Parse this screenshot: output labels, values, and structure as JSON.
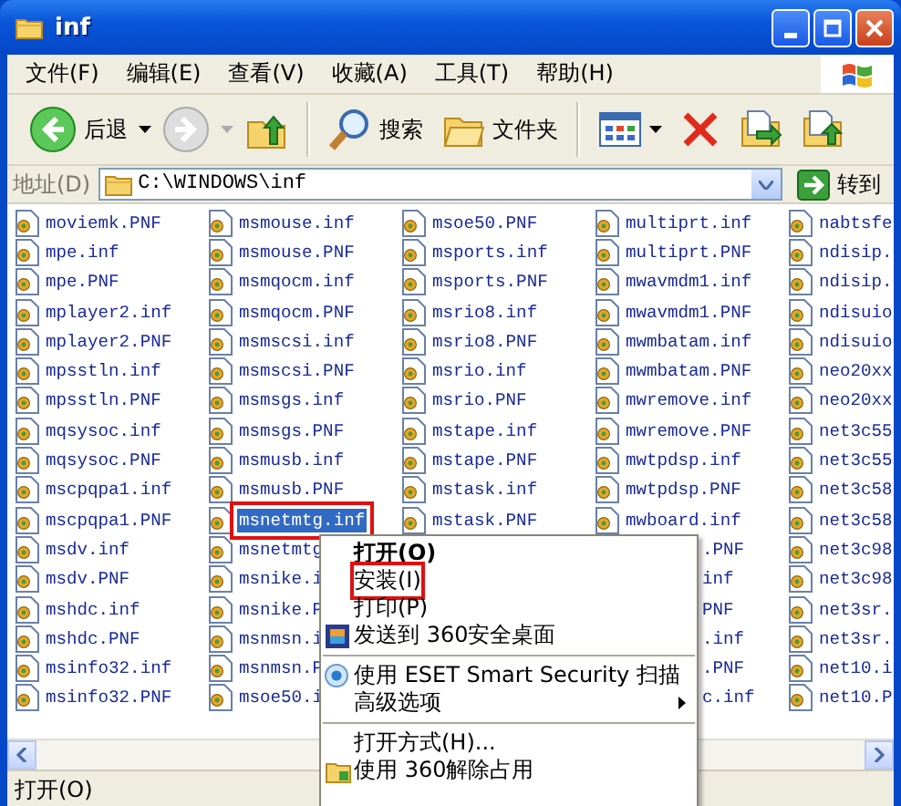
{
  "window": {
    "title": "inf"
  },
  "menu_bar": [
    "文件(F)",
    "编辑(E)",
    "查看(V)",
    "收藏(A)",
    "工具(T)",
    "帮助(H)"
  ],
  "toolbar": [
    {
      "kind": "back",
      "label": "后退",
      "disabled": false
    },
    {
      "kind": "forward",
      "disabled": true
    },
    {
      "kind": "up"
    },
    {
      "kind": "divider"
    },
    {
      "kind": "search",
      "label": "搜索"
    },
    {
      "kind": "folders",
      "label": "文件夹"
    },
    {
      "kind": "divider"
    },
    {
      "kind": "views"
    },
    {
      "kind": "delete"
    },
    {
      "kind": "move"
    },
    {
      "kind": "copy"
    }
  ],
  "address_bar": {
    "label": "地址(D)",
    "value": "C:\\WINDOWS\\inf",
    "go": "转到"
  },
  "file_columns": [
    {
      "items": [
        {
          "name": "moviemk.PNF",
          "kind": "file",
          "selected": false,
          "marked": false
        },
        {
          "name": "mpe.inf",
          "kind": "file",
          "selected": false,
          "marked": false
        },
        {
          "name": "mpe.PNF",
          "kind": "file",
          "selected": false,
          "marked": false
        },
        {
          "name": "mplayer2.inf",
          "kind": "file",
          "selected": false,
          "marked": false
        },
        {
          "name": "mplayer2.PNF",
          "kind": "file",
          "selected": false,
          "marked": false
        },
        {
          "name": "mpsstln.inf",
          "kind": "file",
          "selected": false,
          "marked": false
        },
        {
          "name": "mpsstln.PNF",
          "kind": "file",
          "selected": false,
          "marked": false
        },
        {
          "name": "mqsysoc.inf",
          "kind": "file",
          "selected": false,
          "marked": false
        },
        {
          "name": "mqsysoc.PNF",
          "kind": "file",
          "selected": false,
          "marked": false
        },
        {
          "name": "mscpqpa1.inf",
          "kind": "file",
          "selected": false,
          "marked": false
        },
        {
          "name": "mscpqpa1.PNF",
          "kind": "file",
          "selected": false,
          "marked": false
        },
        {
          "name": "msdv.inf",
          "kind": "file",
          "selected": false,
          "marked": false
        },
        {
          "name": "msdv.PNF",
          "kind": "file",
          "selected": false,
          "marked": false
        },
        {
          "name": "mshdc.inf",
          "kind": "file",
          "selected": false,
          "marked": false
        },
        {
          "name": "mshdc.PNF",
          "kind": "file",
          "selected": false,
          "marked": false
        },
        {
          "name": "msinfo32.inf",
          "kind": "file",
          "selected": false,
          "marked": false
        },
        {
          "name": "msinfo32.PNF",
          "kind": "file",
          "selected": false,
          "marked": false
        }
      ]
    },
    {
      "items": [
        {
          "name": "msmouse.inf",
          "kind": "file",
          "selected": false,
          "marked": false
        },
        {
          "name": "msmouse.PNF",
          "kind": "file",
          "selected": false,
          "marked": false
        },
        {
          "name": "msmqocm.inf",
          "kind": "file",
          "selected": false,
          "marked": false
        },
        {
          "name": "msmqocm.PNF",
          "kind": "file",
          "selected": false,
          "marked": false
        },
        {
          "name": "msmscsi.inf",
          "kind": "file",
          "selected": false,
          "marked": false
        },
        {
          "name": "msmscsi.PNF",
          "kind": "file",
          "selected": false,
          "marked": false
        },
        {
          "name": "msmsgs.inf",
          "kind": "file",
          "selected": false,
          "marked": false
        },
        {
          "name": "msmsgs.PNF",
          "kind": "file",
          "selected": false,
          "marked": false
        },
        {
          "name": "msmusb.inf",
          "kind": "file",
          "selected": false,
          "marked": false
        },
        {
          "name": "msmusb.PNF",
          "kind": "file",
          "selected": false,
          "marked": false
        },
        {
          "name": "msnetmtg.inf",
          "kind": "file",
          "selected": true,
          "marked": true
        },
        {
          "name": "msnetmtg",
          "kind": "file",
          "selected": false,
          "marked": false
        },
        {
          "name": "msnike.i",
          "kind": "file",
          "selected": false,
          "marked": false
        },
        {
          "name": "msnike.P",
          "kind": "file",
          "selected": false,
          "marked": false
        },
        {
          "name": "msnmsn.i",
          "kind": "file",
          "selected": false,
          "marked": false
        },
        {
          "name": "msnmsn.P",
          "kind": "file",
          "selected": false,
          "marked": false
        },
        {
          "name": "msoe50.i",
          "kind": "file",
          "selected": false,
          "marked": false
        }
      ]
    },
    {
      "items": [
        {
          "name": "msoe50.PNF",
          "kind": "file",
          "selected": false,
          "marked": false
        },
        {
          "name": "msports.inf",
          "kind": "file",
          "selected": false,
          "marked": false
        },
        {
          "name": "msports.PNF",
          "kind": "file",
          "selected": false,
          "marked": false
        },
        {
          "name": "msrio8.inf",
          "kind": "file",
          "selected": false,
          "marked": false
        },
        {
          "name": "msrio8.PNF",
          "kind": "file",
          "selected": false,
          "marked": false
        },
        {
          "name": "msrio.inf",
          "kind": "file",
          "selected": false,
          "marked": false
        },
        {
          "name": "msrio.PNF",
          "kind": "file",
          "selected": false,
          "marked": false
        },
        {
          "name": "mstape.inf",
          "kind": "file",
          "selected": false,
          "marked": false
        },
        {
          "name": "mstape.PNF",
          "kind": "file",
          "selected": false,
          "marked": false
        },
        {
          "name": "mstask.inf",
          "kind": "file",
          "selected": false,
          "marked": false
        },
        {
          "name": "mstask.PNF",
          "kind": "file",
          "selected": false,
          "marked": false
        }
      ]
    },
    {
      "items": [
        {
          "name": "multiprt.inf",
          "kind": "file",
          "selected": false,
          "marked": false
        },
        {
          "name": "multiprt.PNF",
          "kind": "file",
          "selected": false,
          "marked": false
        },
        {
          "name": "mwavmdm1.inf",
          "kind": "file",
          "selected": false,
          "marked": false
        },
        {
          "name": "mwavmdm1.PNF",
          "kind": "file",
          "selected": false,
          "marked": false
        },
        {
          "name": "mwmbatam.inf",
          "kind": "file",
          "selected": false,
          "marked": false
        },
        {
          "name": "mwmbatam.PNF",
          "kind": "file",
          "selected": false,
          "marked": false
        },
        {
          "name": "mwremove.inf",
          "kind": "file",
          "selected": false,
          "marked": false
        },
        {
          "name": "mwremove.PNF",
          "kind": "file",
          "selected": false,
          "marked": false
        },
        {
          "name": "mwtpdsp.inf",
          "kind": "file",
          "selected": false,
          "marked": false
        },
        {
          "name": "mwtpdsp.PNF",
          "kind": "file",
          "selected": false,
          "marked": false
        },
        {
          "name": "mwboard.inf",
          "kind": "file",
          "selected": false,
          "marked": false
        },
        {
          "name": ".PNF",
          "kind": "cut",
          "selected": false,
          "marked": false
        },
        {
          "name": "inf",
          "kind": "cut",
          "selected": false,
          "marked": false
        },
        {
          "name": "PNF",
          "kind": "cut",
          "selected": false,
          "marked": false
        },
        {
          "name": ".inf",
          "kind": "cut",
          "selected": false,
          "marked": false
        },
        {
          "name": ".PNF",
          "kind": "cut",
          "selected": false,
          "marked": false
        },
        {
          "name": "c.inf",
          "kind": "cut",
          "selected": false,
          "marked": false
        }
      ]
    },
    {
      "items": [
        {
          "name": "nabtsfe",
          "kind": "file",
          "selected": false,
          "marked": false
        },
        {
          "name": "ndisip.",
          "kind": "file",
          "selected": false,
          "marked": false
        },
        {
          "name": "ndisip.",
          "kind": "file",
          "selected": false,
          "marked": false
        },
        {
          "name": "ndisuio",
          "kind": "file",
          "selected": false,
          "marked": false
        },
        {
          "name": "ndisuio",
          "kind": "file",
          "selected": false,
          "marked": false
        },
        {
          "name": "neo20xx",
          "kind": "file",
          "selected": false,
          "marked": false
        },
        {
          "name": "neo20xx",
          "kind": "file",
          "selected": false,
          "marked": false
        },
        {
          "name": "net3c55",
          "kind": "file",
          "selected": false,
          "marked": false
        },
        {
          "name": "net3c55",
          "kind": "file",
          "selected": false,
          "marked": false
        },
        {
          "name": "net3c58",
          "kind": "file",
          "selected": false,
          "marked": false
        },
        {
          "name": "net3c58",
          "kind": "file",
          "selected": false,
          "marked": false
        },
        {
          "name": "net3c98",
          "kind": "file",
          "selected": false,
          "marked": false
        },
        {
          "name": "net3c98",
          "kind": "file",
          "selected": false,
          "marked": false
        },
        {
          "name": "net3sr.",
          "kind": "file",
          "selected": false,
          "marked": false
        },
        {
          "name": "net3sr.",
          "kind": "file",
          "selected": false,
          "marked": false
        },
        {
          "name": "net10.i",
          "kind": "file",
          "selected": false,
          "marked": false
        },
        {
          "name": "net10.P",
          "kind": "file",
          "selected": false,
          "marked": false
        }
      ]
    }
  ],
  "context_menu": [
    {
      "kind": "command",
      "label": "打开(O)",
      "default": true,
      "marked": false
    },
    {
      "kind": "command",
      "label": "安装(I)",
      "default": false,
      "marked": true
    },
    {
      "kind": "command",
      "label": "打印(P)",
      "default": false,
      "marked": false
    },
    {
      "kind": "send",
      "label": "发送到 360安全桌面",
      "default": false,
      "marked": false
    },
    {
      "kind": "separator"
    },
    {
      "kind": "scan",
      "label": "使用 ESET Smart Security 扫描",
      "default": false,
      "marked": false
    },
    {
      "kind": "submenu",
      "label": "高级选项",
      "default": false,
      "marked": false
    },
    {
      "kind": "separator"
    },
    {
      "kind": "command",
      "label": "打开方式(H)...",
      "default": false,
      "marked": false
    },
    {
      "kind": "unlock",
      "label": "使用 360解除占用",
      "default": false,
      "marked": false
    }
  ],
  "status_bar": {
    "text": "打开(O)"
  }
}
